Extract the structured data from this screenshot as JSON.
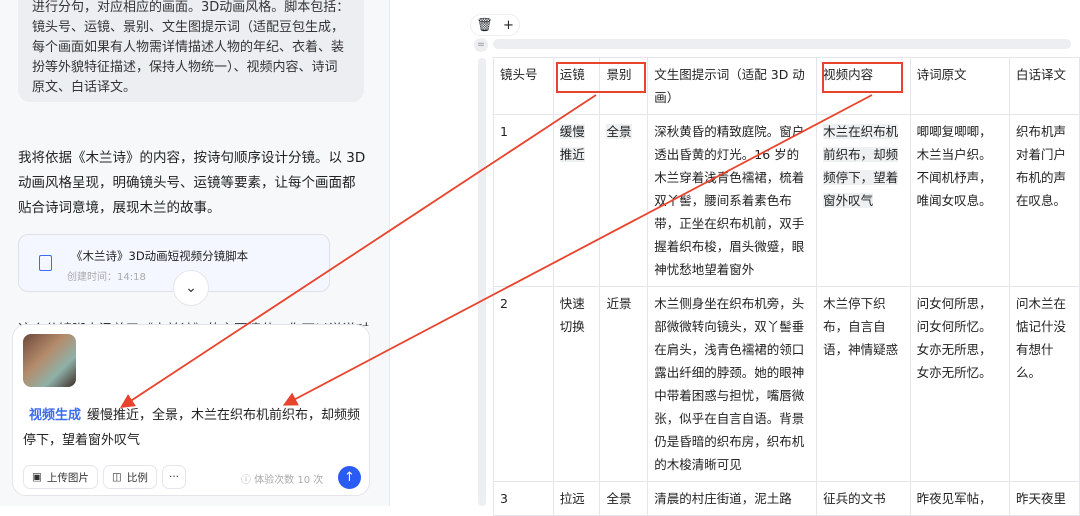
{
  "chat": {
    "user_bubble": "进行分句，对应相应的画面。3D动画风格。脚本包括：镜头号、运镜、景别、文生图提示词（适配豆包生成，每个画面如果有人物需详情描述人物的年纪、衣着、装扮等外貌特征描述，保持人物统一）、视频内容、诗词原文、白话译文。",
    "reply": "我将依据《木兰诗》的内容，按诗句顺序设计分镜。以 3D 动画风格呈现，明确镜头号、运镜等要素，让每个画面都贴合诗词意境，展现木兰的故事。",
    "doc_title": "《木兰诗》3D动画短视频分镜脚本",
    "doc_created": "创建时间：14:18",
    "cut_text": "这个分镜脚本涵盖了《木兰诗》的主要情节，你可以说说对"
  },
  "composer": {
    "tag": "视频生成",
    "prompt": "缓慢推近，全景，木兰在织布机前织布，却频频停下，望着窗外叹气",
    "upload_label": "上传图片",
    "ratio_label": "比例",
    "more_label": "···",
    "quota": "ⓘ 体验次数 10 次"
  },
  "table": {
    "headers": [
      "镜头号",
      "运镜",
      "景别",
      "文生图提示词（适配 3D 动画）",
      "视频内容",
      "诗词原文",
      "白话译文"
    ],
    "rows": [
      [
        "1",
        "缓慢推近",
        "全景",
        "深秋黄昏的精致庭院。窗户透出昏黄的灯光。16 岁的木兰穿着浅青色襦裙，梳着双丫髻，腰间系着素色布带，正坐在织布机前，双手握着织布梭，眉头微蹙，眼神忧愁地望着窗外",
        "木兰在织布机前织布，却频频停下，望着窗外叹气",
        "唧唧复唧唧，木兰当户织。不闻机杼声，唯闻女叹息。",
        "织布机声对着门户布机的声在叹息。"
      ],
      [
        "2",
        "快速切换",
        "近景",
        "木兰侧身坐在织布机旁，头部微微转向镜头，双丫髻垂在肩头，浅青色襦裙的领口露出纤细的脖颈。她的眼神中带着困惑与担忧，嘴唇微张，似乎在自言自语。背景仍是昏暗的织布房，织布机的木梭清晰可见",
        "木兰停下织布，自言自语，神情疑惑",
        "问女何所思，问女何所忆。女亦无所思，女亦无所忆。",
        "问木兰在惦记什没有想什么。"
      ],
      [
        "3",
        "拉远",
        "全景",
        "清晨的村庄街道，泥土路",
        "征兵的文书",
        "昨夜见军帖，",
        "昨天夜里"
      ]
    ]
  },
  "colors": {
    "accent": "#2a5cf5",
    "annotation": "#e8442d"
  }
}
